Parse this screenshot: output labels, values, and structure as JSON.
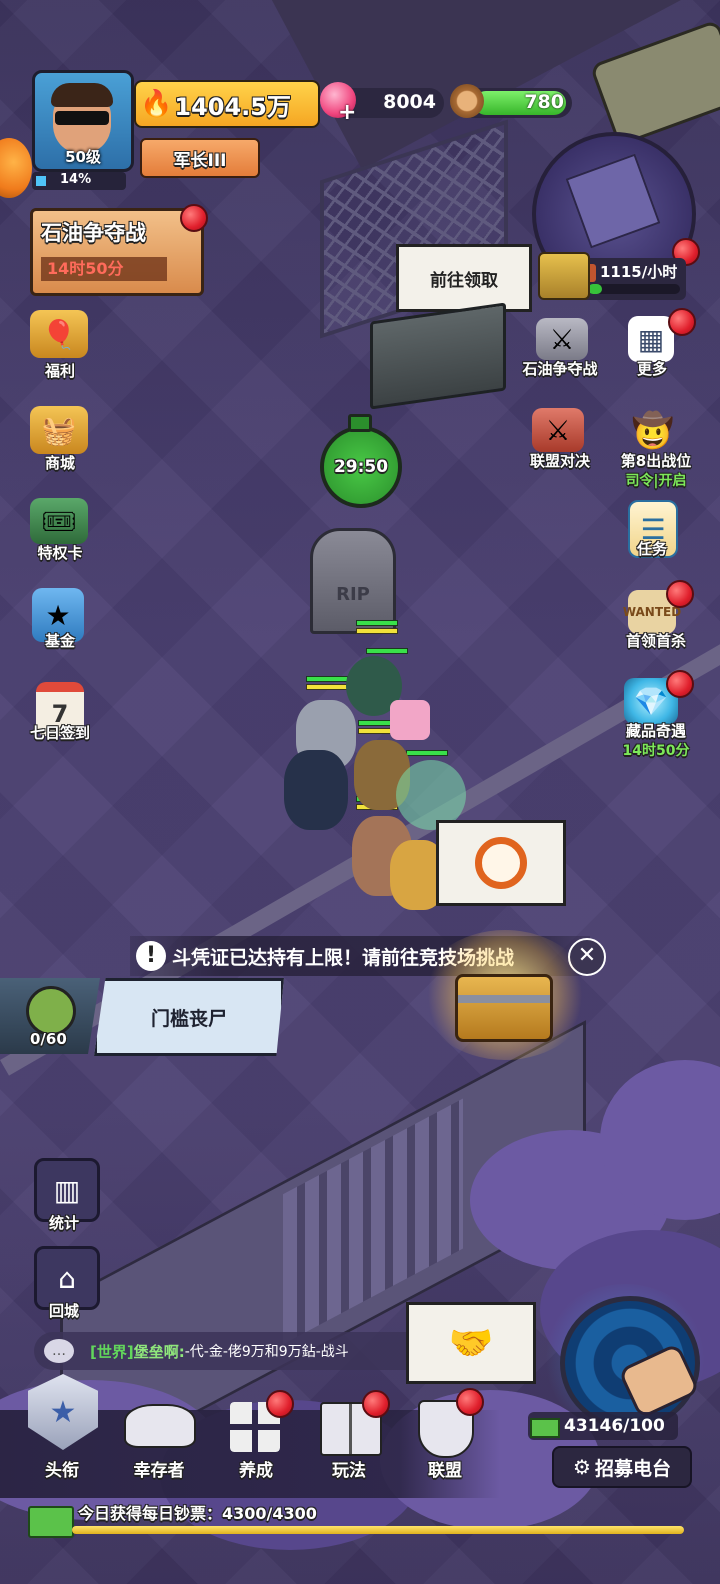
{
  "player": {
    "level": "50级",
    "xp_percent": "14%",
    "xp_fraction": 0.14,
    "rank": "军长III",
    "power": "1404.5万"
  },
  "currencies": {
    "gems": "8004",
    "wood": "780",
    "wood_fill": 0.85
  },
  "event_oil": {
    "title": "石油争夺战",
    "timer": "14时50分"
  },
  "left_menu": [
    {
      "label": "福利",
      "icon": "balloon-gift-icon"
    },
    {
      "label": "商城",
      "icon": "shop-basket-icon"
    },
    {
      "label": "特权卡",
      "icon": "privilege-card-icon"
    },
    {
      "label": "基金",
      "icon": "fund-book-icon"
    },
    {
      "label": "七日签到",
      "icon": "calendar-icon",
      "day": "7"
    }
  ],
  "right_menu": [
    {
      "label": "石油争夺战",
      "icon": "oil-war-icon"
    },
    {
      "label": "更多",
      "icon": "grid-icon"
    },
    {
      "label": "联盟对决",
      "icon": "crossed-swords-icon"
    },
    {
      "label": "第8出战位",
      "sub": "司令|开启",
      "icon": "cowboy-hat-icon"
    },
    {
      "label": "任务",
      "icon": "task-clipboard-icon"
    },
    {
      "label": "首领首杀",
      "icon": "wanted-poster-icon"
    },
    {
      "label": "藏品奇遇",
      "sub": "14时50分",
      "icon": "crystal-icon"
    }
  ],
  "minimap": {
    "production": "1115/小时"
  },
  "bubbles": {
    "claim": "前往领取"
  },
  "timer": {
    "countdown": "29:50"
  },
  "tombstone": {
    "text": "RIP"
  },
  "notice": {
    "text": "斗凭证已达持有上限！请前往竞技场挑战"
  },
  "enemy_wave": {
    "name": "门槛丧尸",
    "progress": "0/60"
  },
  "side_buttons": [
    {
      "label": "统计",
      "icon": "bar-chart-icon"
    },
    {
      "label": "回城",
      "icon": "return-home-icon"
    }
  ],
  "chat": {
    "channel": "[世界]",
    "sender": "堡垒啊:",
    "message": " -代-金-佬9万和9万鉆-战斗"
  },
  "radar": {
    "cash": "43146/100",
    "recruit_label": "招募电台"
  },
  "bottom_nav": [
    {
      "label": "头衔",
      "icon": "star-badge-icon"
    },
    {
      "label": "幸存者",
      "icon": "hat-icon"
    },
    {
      "label": "养成",
      "icon": "grid-icon"
    },
    {
      "label": "玩法",
      "icon": "book-icon"
    },
    {
      "label": "联盟",
      "icon": "shield-icon"
    }
  ],
  "daily_cash": {
    "text": "今日获得每日钞票：4300/4300",
    "fill": 1.0
  }
}
